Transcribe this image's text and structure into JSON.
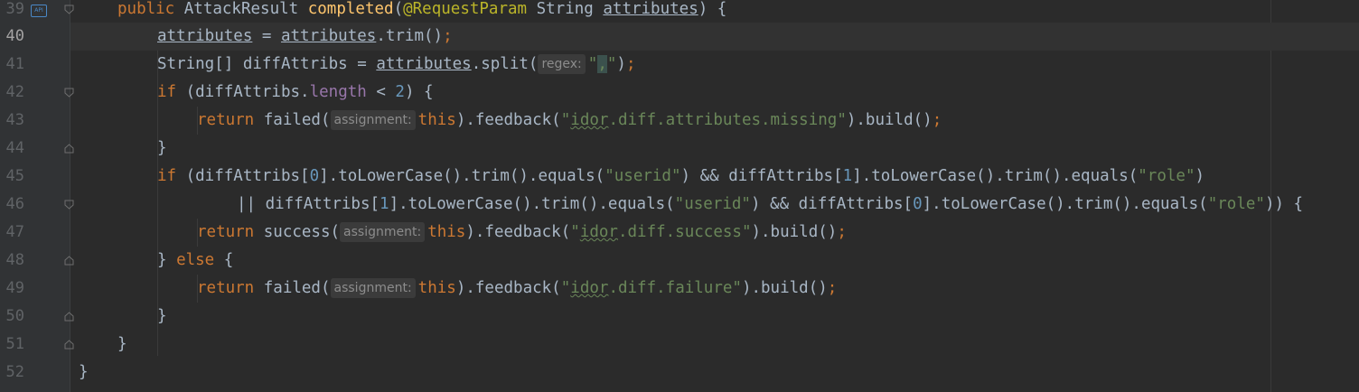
{
  "editor": {
    "gutter": {
      "line_numbers": [
        "39",
        "40",
        "41",
        "42",
        "43",
        "44",
        "45",
        "46",
        "47",
        "48",
        "49",
        "50",
        "51",
        "52"
      ],
      "current_line": "40",
      "api_badge": "API"
    },
    "code": {
      "l39": {
        "kw_public": "public",
        "type": " AttackResult ",
        "method": "completed",
        "paren_open": "(",
        "annotation": "@RequestParam",
        "type2": " String ",
        "param": "attributes",
        "rest": ") {"
      },
      "l40": {
        "var": "attributes",
        "mid": " = ",
        "var2": "attributes",
        "call": ".trim()",
        "semi": ";"
      },
      "l41": {
        "decl": "String[] diffAttribs = ",
        "var": "attributes",
        "call": ".split(",
        "hint": "regex:",
        "q1": "\"",
        "str": ",",
        "q2": "\"",
        "close": ")",
        "semi": ";"
      },
      "l42": {
        "kw_if": "if",
        "pre": " (diffAttribs.",
        "field": "length",
        "op": " < ",
        "num": "2",
        "rest": ") {"
      },
      "l43": {
        "kw_return": "return",
        "call": " failed(",
        "hint": "assignment:",
        "kw_this": "this",
        "mid": ").feedback(",
        "q1": "\"",
        "str_typo": "idor",
        "str": ".diff.attributes.missing",
        "q2": "\"",
        "end": ").build()",
        "semi": ";"
      },
      "l44": {
        "brace": "}"
      },
      "l45": {
        "kw_if": "if",
        "a": " (diffAttribs[",
        "n0": "0",
        "b": "].toLowerCase().trim().equals(",
        "s1": "\"userid\"",
        "c": ") && diffAttribs[",
        "n1": "1",
        "d": "].toLowerCase().trim().equals(",
        "s2": "\"role\"",
        "e": ")"
      },
      "l46": {
        "a": "|| diffAttribs[",
        "n1": "1",
        "b": "].toLowerCase().trim().equals(",
        "s1": "\"userid\"",
        "c": ") && diffAttribs[",
        "n0": "0",
        "d": "].toLowerCase().trim().equals(",
        "s2": "\"role\"",
        "e": ")) {"
      },
      "l47": {
        "kw_return": "return",
        "call": " success(",
        "hint": "assignment:",
        "kw_this": "this",
        "mid": ").feedback(",
        "q1": "\"",
        "str_typo": "idor",
        "str": ".diff.success",
        "q2": "\"",
        "end": ").build()",
        "semi": ";"
      },
      "l48": {
        "brace": "} ",
        "kw_else": "else",
        "rest": " {"
      },
      "l49": {
        "kw_return": "return",
        "call": " failed(",
        "hint": "assignment:",
        "kw_this": "this",
        "mid": ").feedback(",
        "q1": "\"",
        "str_typo": "idor",
        "str": ".diff.failure",
        "q2": "\"",
        "end": ").build()",
        "semi": ";"
      },
      "l50": {
        "brace": "}"
      },
      "l51": {
        "brace": "}"
      },
      "l52": {
        "brace": "}"
      }
    }
  }
}
